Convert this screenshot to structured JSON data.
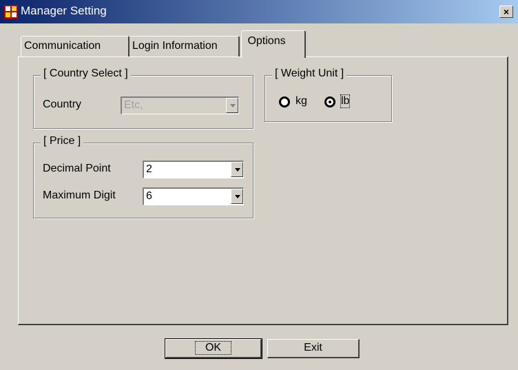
{
  "window": {
    "title": "Manager Setting",
    "close_label": "×"
  },
  "tabs": [
    {
      "label": "Communication"
    },
    {
      "label": "Login Information"
    },
    {
      "label": "Options",
      "selected": true
    }
  ],
  "country_group": {
    "title": "[ Country Select ]",
    "country_label": "Country",
    "country_value": "Etc,"
  },
  "weight_group": {
    "title": "[ Weight Unit ]",
    "options": [
      {
        "label": "kg",
        "checked": false
      },
      {
        "label": "lb",
        "checked": true
      }
    ]
  },
  "price_group": {
    "title": "[ Price ]",
    "decimal_label": "Decimal Point",
    "decimal_value": "2",
    "max_digit_label": "Maximum Digit",
    "max_digit_value": "6"
  },
  "buttons": {
    "ok": "OK",
    "exit": "Exit"
  },
  "colors": {
    "titlebar_start": "#0a246a",
    "titlebar_end": "#a6caf0",
    "face": "#d4d0c8"
  }
}
